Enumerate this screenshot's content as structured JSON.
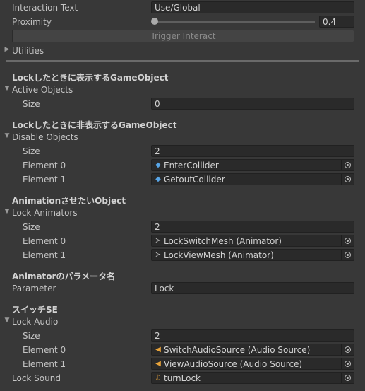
{
  "interaction_text": {
    "label": "Interaction Text",
    "value": "Use/Global"
  },
  "proximity": {
    "label": "Proximity",
    "value": "0.4",
    "fraction": 0.0
  },
  "trigger_button": {
    "label": "Trigger Interact"
  },
  "utilities": {
    "label": "Utilities"
  },
  "section_active": {
    "header": "Lockしたときに表示するGameObject",
    "list_label": "Active Objects",
    "size_label": "Size",
    "size": "0"
  },
  "section_disable": {
    "header": "Lockしたときに非表示するGameObject",
    "list_label": "Disable Objects",
    "size_label": "Size",
    "size": "2",
    "elements": [
      {
        "label": "Element 0",
        "value": "EnterCollider",
        "icon": "gameobject-icon"
      },
      {
        "label": "Element 1",
        "value": "GetoutCollider",
        "icon": "gameobject-icon"
      }
    ]
  },
  "section_anim": {
    "header": "AnimationさせたいObject",
    "list_label": "Lock Animators",
    "size_label": "Size",
    "size": "2",
    "elements": [
      {
        "label": "Element 0",
        "value": "LockSwitchMesh (Animator)",
        "icon": "animator-icon"
      },
      {
        "label": "Element 1",
        "value": "LockViewMesh (Animator)",
        "icon": "animator-icon"
      }
    ]
  },
  "section_param": {
    "header": "Animatorのパラメータ名",
    "label": "Parameter",
    "value": "Lock"
  },
  "section_audio": {
    "header": "スイッチSE",
    "list_label": "Lock Audio",
    "size_label": "Size",
    "size": "2",
    "elements": [
      {
        "label": "Element 0",
        "value": "SwitchAudioSource (Audio Source)",
        "icon": "audio-source-icon"
      },
      {
        "label": "Element 1",
        "value": "ViewAudioSource (Audio Source)",
        "icon": "audio-source-icon"
      }
    ],
    "sound_label": "Lock Sound",
    "sound_value": "turnLock",
    "sound_icon": "audio-clip-icon"
  }
}
